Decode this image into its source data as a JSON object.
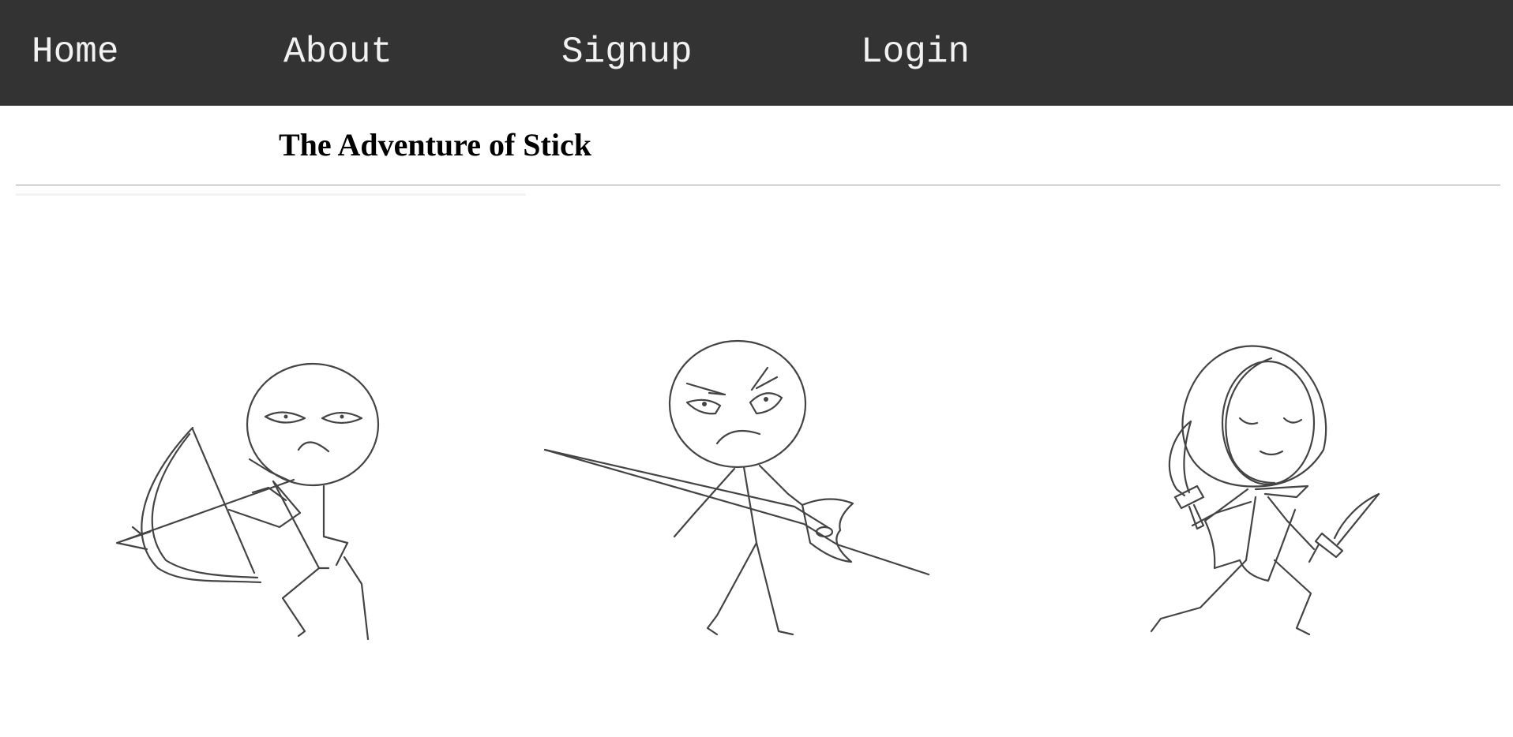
{
  "nav": {
    "home": "Home",
    "about": "About",
    "signup": "Signup",
    "login": "Login"
  },
  "page": {
    "title": "The Adventure of Stick"
  },
  "colors": {
    "navbar_background": "#333333",
    "nav_text": "#f2f2f2",
    "rule": "#9e9e9e"
  },
  "figures": [
    {
      "name": "archer-stick-figure"
    },
    {
      "name": "spear-stick-figure"
    },
    {
      "name": "hooded-dagger-stick-figure"
    }
  ]
}
